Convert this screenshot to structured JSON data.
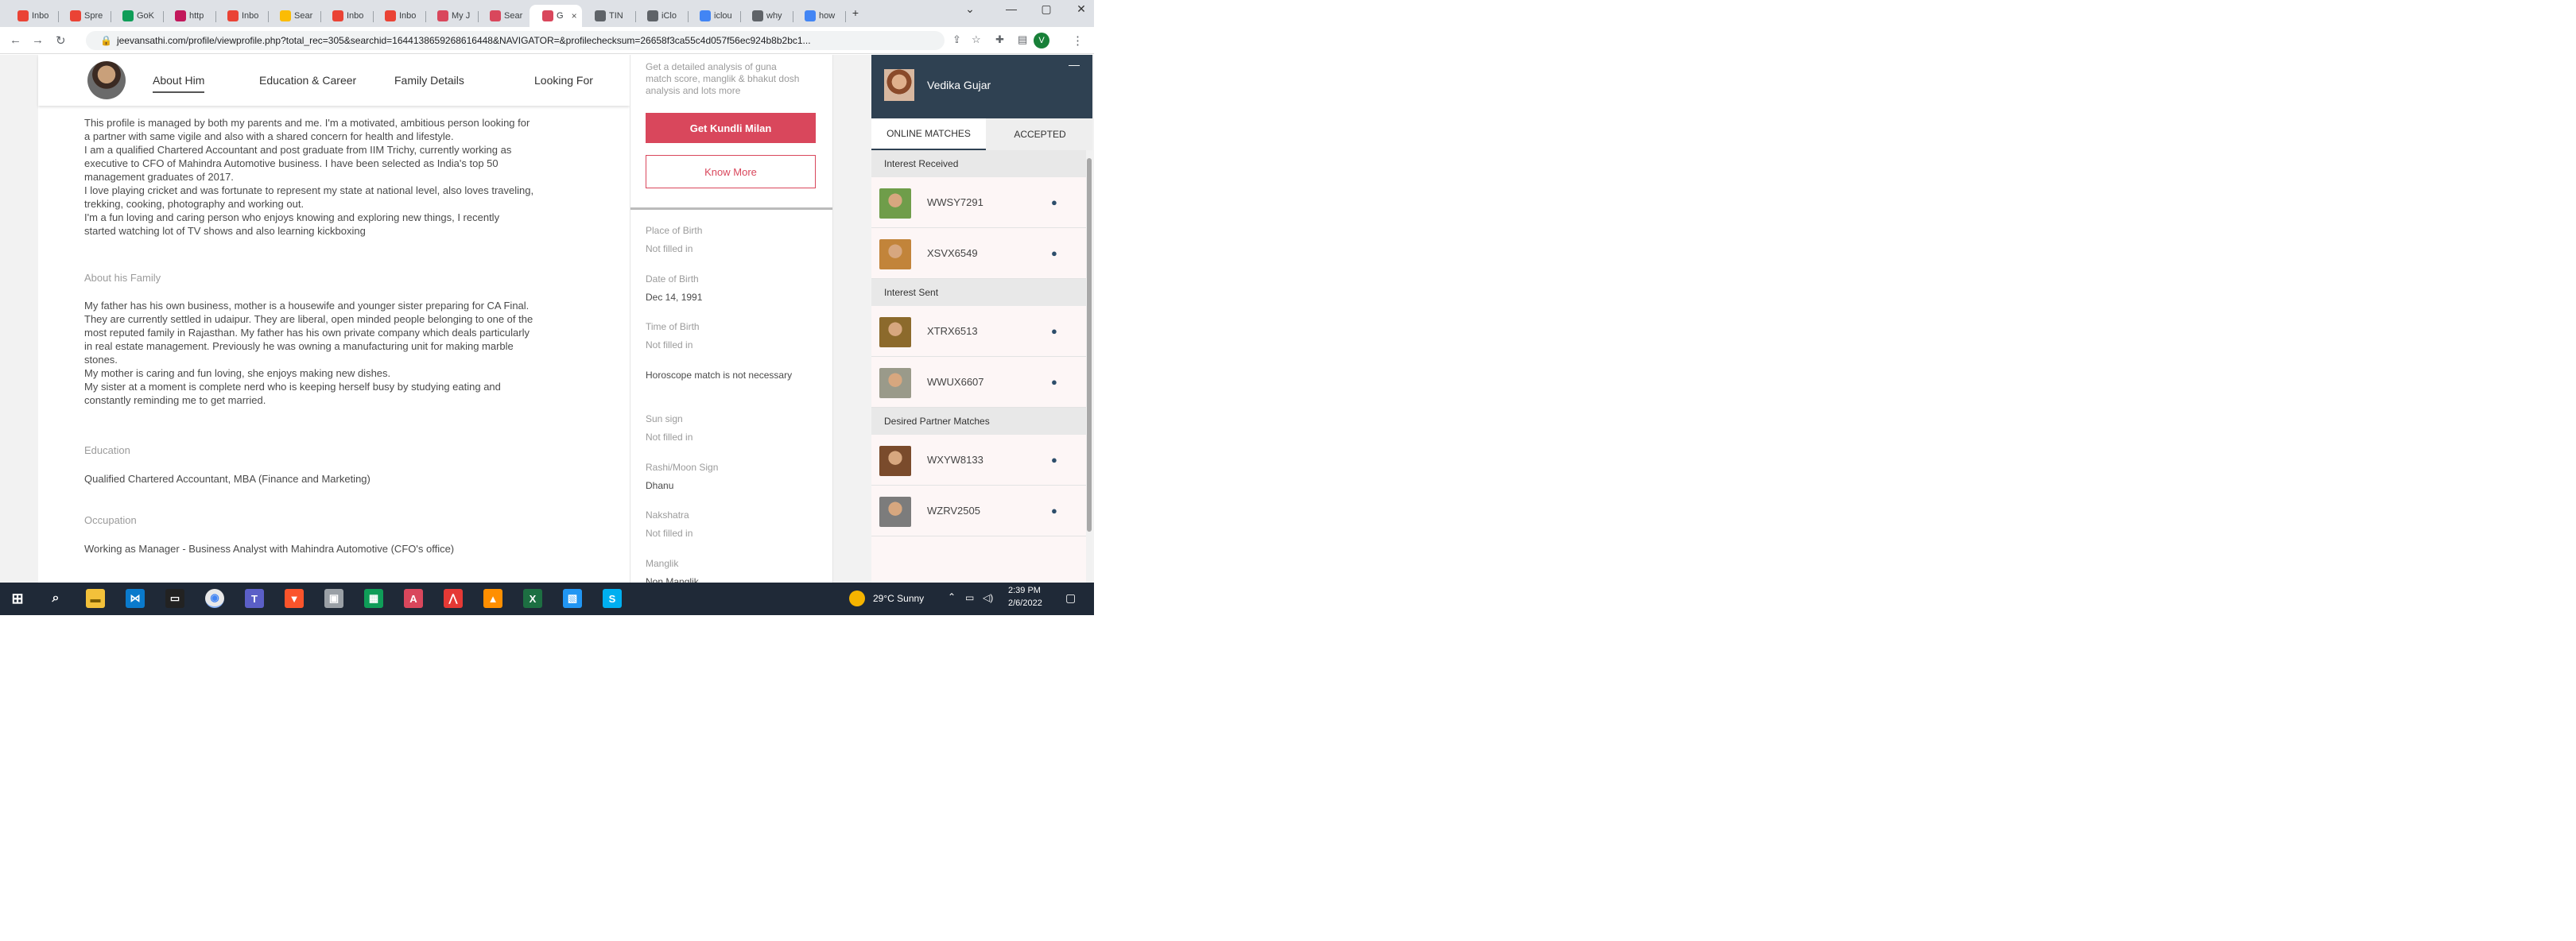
{
  "browser": {
    "tabs": [
      {
        "label": "Inbo",
        "icon": "gmail-icon",
        "color": "#ea4335"
      },
      {
        "label": "Spre",
        "icon": "gmail-icon",
        "color": "#ea4335"
      },
      {
        "label": "GoK",
        "icon": "sheets-icon",
        "color": "#0f9d58"
      },
      {
        "label": "http",
        "icon": "site-icon",
        "color": "#c2185b"
      },
      {
        "label": "Inbo",
        "icon": "gmail-icon",
        "color": "#ea4335"
      },
      {
        "label": "Sear",
        "icon": "search-icon",
        "color": "#fbbc04"
      },
      {
        "label": "Inbo",
        "icon": "gmail-icon",
        "color": "#ea4335"
      },
      {
        "label": "Inbo",
        "icon": "gmail-icon",
        "color": "#ea4335"
      },
      {
        "label": "My J",
        "icon": "jeevansathi-icon",
        "color": "#d9475c"
      },
      {
        "label": "Sear",
        "icon": "jeevansathi-icon",
        "color": "#d9475c"
      },
      {
        "label": "G",
        "icon": "jeevansathi-icon",
        "color": "#d9475c",
        "active": true
      },
      {
        "label": "TIN",
        "icon": "globe-icon",
        "color": "#5f6368"
      },
      {
        "label": "iClo",
        "icon": "apple-icon",
        "color": "#5f6368"
      },
      {
        "label": "iclou",
        "icon": "google-icon",
        "color": "#4285f4"
      },
      {
        "label": "why",
        "icon": "apple-icon",
        "color": "#5f6368"
      },
      {
        "label": "how",
        "icon": "google-icon",
        "color": "#4285f4"
      }
    ],
    "new_tab": "+",
    "url": "jeevansathi.com/profile/viewprofile.php?total_rec=305&searchid=1644138659268616448&NAVIGATOR=&profilechecksum=26658f3ca55c4d057f56ec924b8b2bc1...",
    "profile_initial": "V"
  },
  "profile_nav": {
    "tabs": [
      "About Him",
      "Education & Career",
      "Family Details",
      "Looking For"
    ]
  },
  "about": {
    "lines": [
      "This profile is managed by both my parents and me. I'm a motivated, ambitious person looking for",
      "a partner with same vigile and also with a shared concern for health and lifestyle.",
      "I am a qualified Chartered Accountant and post graduate from IIM Trichy, currently working as",
      "executive to CFO of Mahindra Automotive business. I have been selected as India's top 50",
      "management graduates of 2017.",
      "I love playing cricket and was fortunate to represent my state at national level, also loves traveling,",
      "trekking, cooking, photography and working out.",
      "I'm a fun loving and caring person who enjoys knowing and exploring new things, I recently",
      "started watching lot of TV shows and also learning kickboxing"
    ]
  },
  "family": {
    "heading": "About his Family",
    "lines": [
      "My father has his own business, mother is a housewife and younger sister preparing for CA Final.",
      "They are currently settled in udaipur. They are liberal, open minded people belonging to one of the",
      "most reputed family in Rajasthan. My father has his own private company which deals particularly",
      "in real estate management. Previously he was owning a manufacturing unit for making marble",
      "stones.",
      "My mother is caring and fun loving, she enjoys making new dishes.",
      "My sister at a moment is complete nerd who is keeping herself busy by studying eating and",
      "constantly reminding me to get married."
    ]
  },
  "education": {
    "heading": "Education",
    "value": "Qualified Chartered Accountant, MBA (Finance and Marketing)"
  },
  "occupation": {
    "heading": "Occupation",
    "value": "Working as Manager - Business Analyst with Mahindra Automotive (CFO's office)"
  },
  "kundli": {
    "description": "Get a detailed analysis of guna match score, manglik & bhakut dosh analysis and lots more",
    "button": "Get Kundli Milan",
    "know_more": "Know More"
  },
  "horoscope": [
    {
      "label": "Place of Birth",
      "value": "Not filled in",
      "muted": true
    },
    {
      "label": "Date of Birth",
      "value": "Dec 14, 1991",
      "muted": false
    },
    {
      "label": "Time of Birth",
      "value": "Not filled in",
      "muted": true
    },
    {
      "label": "",
      "value": "Horoscope match is not necessary",
      "muted": false
    },
    {
      "label": "Sun sign",
      "value": "Not filled in",
      "muted": true
    },
    {
      "label": "Rashi/Moon Sign",
      "value": "Dhanu",
      "muted": false
    },
    {
      "label": "Nakshatra",
      "value": "Not filled in",
      "muted": true
    },
    {
      "label": "Manglik",
      "value": "Non Manglik",
      "muted": false
    }
  ],
  "chat": {
    "user_name": "Vedika Gujar",
    "minimize": "—",
    "tabs": [
      "ONLINE MATCHES",
      "ACCEPTED"
    ],
    "sections": [
      {
        "title": "Interest Received",
        "items": [
          "WWSY7291",
          "XSVX6549"
        ]
      },
      {
        "title": "Interest Sent",
        "items": [
          "XTRX6513",
          "WWUX6607"
        ]
      },
      {
        "title": "Desired Partner Matches",
        "items": [
          "WXYW8133",
          "WZRV2505"
        ]
      }
    ]
  },
  "taskbar": {
    "weather": "29°C  Sunny",
    "time": "2:39 PM",
    "date": "2/6/2022"
  }
}
